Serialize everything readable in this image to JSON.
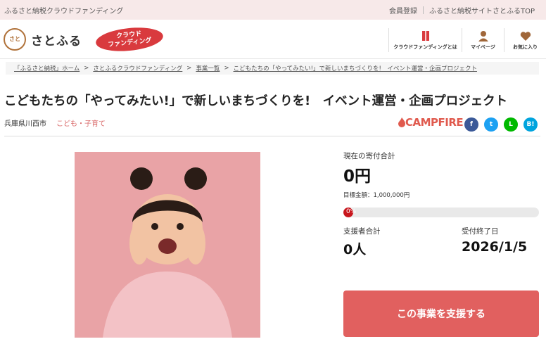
{
  "topbar": {
    "tagline": "ふるさと納税クラウドファンディング",
    "links": [
      "会員登録",
      "ふるさと納税サイトさとふるTOP"
    ]
  },
  "header": {
    "logo_mark": "さと",
    "logo_text": "さとふる",
    "badge_line1": "クラウド",
    "badge_line2": "ファンディング",
    "nav": [
      {
        "label": "クラウドファンディングとは",
        "icon": "book-icon"
      },
      {
        "label": "マイページ",
        "icon": "user-icon"
      },
      {
        "label": "お気に入り",
        "icon": "heart-icon"
      }
    ]
  },
  "breadcrumb": [
    "「ふるさと納税」ホーム",
    "さとふるクラウドファンディング",
    "事業一覧",
    "こどもたちの「やってみたい!」で新しいまちづくりを!　イベント運営・企画プロジェクト"
  ],
  "breadcrumb_sep": ">",
  "project": {
    "title": "こどもたちの「やってみたい!」で新しいまちづくりを!　イベント運営・企画プロジェクト",
    "location": "兵庫県川西市",
    "category": "こども・子育て",
    "platform": "CAMPFIRE",
    "share": [
      {
        "label": "f",
        "icon": "facebook-icon",
        "color": "#3b5998"
      },
      {
        "label": "t",
        "icon": "twitter-icon",
        "color": "#1da1f2"
      },
      {
        "label": "L",
        "icon": "line-icon",
        "color": "#00b900"
      },
      {
        "label": "B!",
        "icon": "hatena-icon",
        "color": "#00a4de"
      }
    ]
  },
  "funding": {
    "total_label": "現在の寄付合計",
    "total_value": "0円",
    "goal_text": "目標金額：1,000,000円",
    "progress_percent": 0,
    "progress_text": "0%",
    "supporters_label": "支援者合計",
    "supporters_value": "0人",
    "deadline_label": "受付終了日",
    "deadline_value": "2026/1/5",
    "button_label": "この事業を支援する"
  },
  "colors": {
    "accent": "#e1605f",
    "brand_red": "#d93a3e",
    "topbar_bg": "#f7e9e9"
  }
}
